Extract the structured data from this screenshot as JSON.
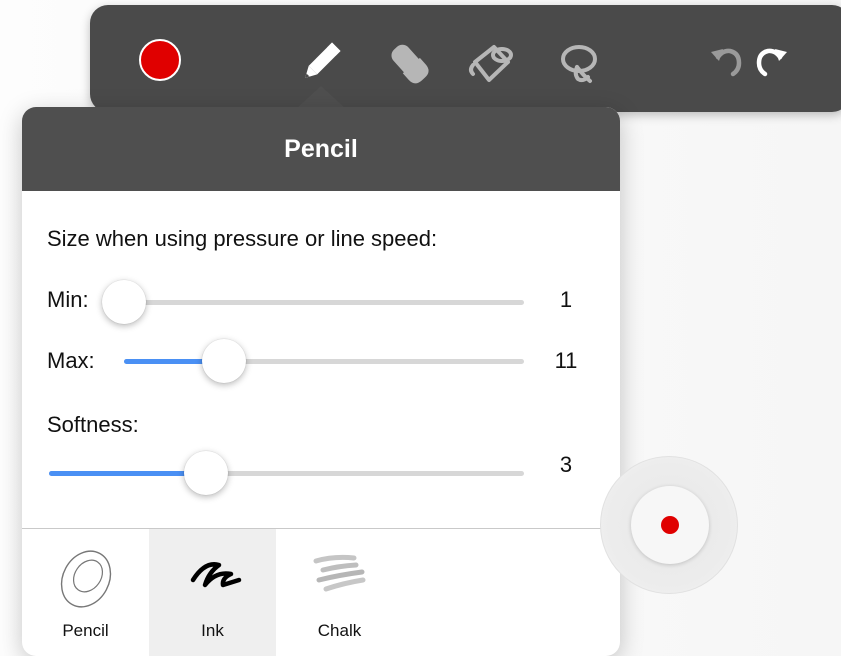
{
  "toolbar": {
    "current_color": "#e00000",
    "tools": [
      {
        "name": "pencil",
        "icon": "pencil-icon",
        "selected": true
      },
      {
        "name": "eraser",
        "icon": "eraser-icon",
        "selected": false
      },
      {
        "name": "fill",
        "icon": "paint-bucket-icon",
        "selected": false
      },
      {
        "name": "lasso",
        "icon": "lasso-icon",
        "selected": false
      }
    ],
    "undo_icon": "undo-icon",
    "redo_icon": "redo-icon"
  },
  "panel": {
    "title": "Pencil",
    "pressure_label": "Size when using pressure or line speed:",
    "min": {
      "label": "Min:",
      "value": "1",
      "level": 0
    },
    "max": {
      "label": "Max:",
      "value": "11",
      "level": 0.25
    },
    "softness": {
      "label": "Softness:",
      "value": "3",
      "level": 0.33
    },
    "brushes": [
      {
        "label": "Pencil",
        "icon": "pencil-brush-icon",
        "selected": false
      },
      {
        "label": "Ink",
        "icon": "ink-brush-icon",
        "selected": true
      },
      {
        "label": "Chalk",
        "icon": "chalk-brush-icon",
        "selected": false
      }
    ]
  },
  "floating_button": {
    "icon": "color-dot-icon",
    "color": "#e00000"
  },
  "colors": {
    "toolbar": "#4a4a4a",
    "panel_header": "#4f4f4f",
    "accent": "#4a90f4",
    "record": "#e00000"
  }
}
